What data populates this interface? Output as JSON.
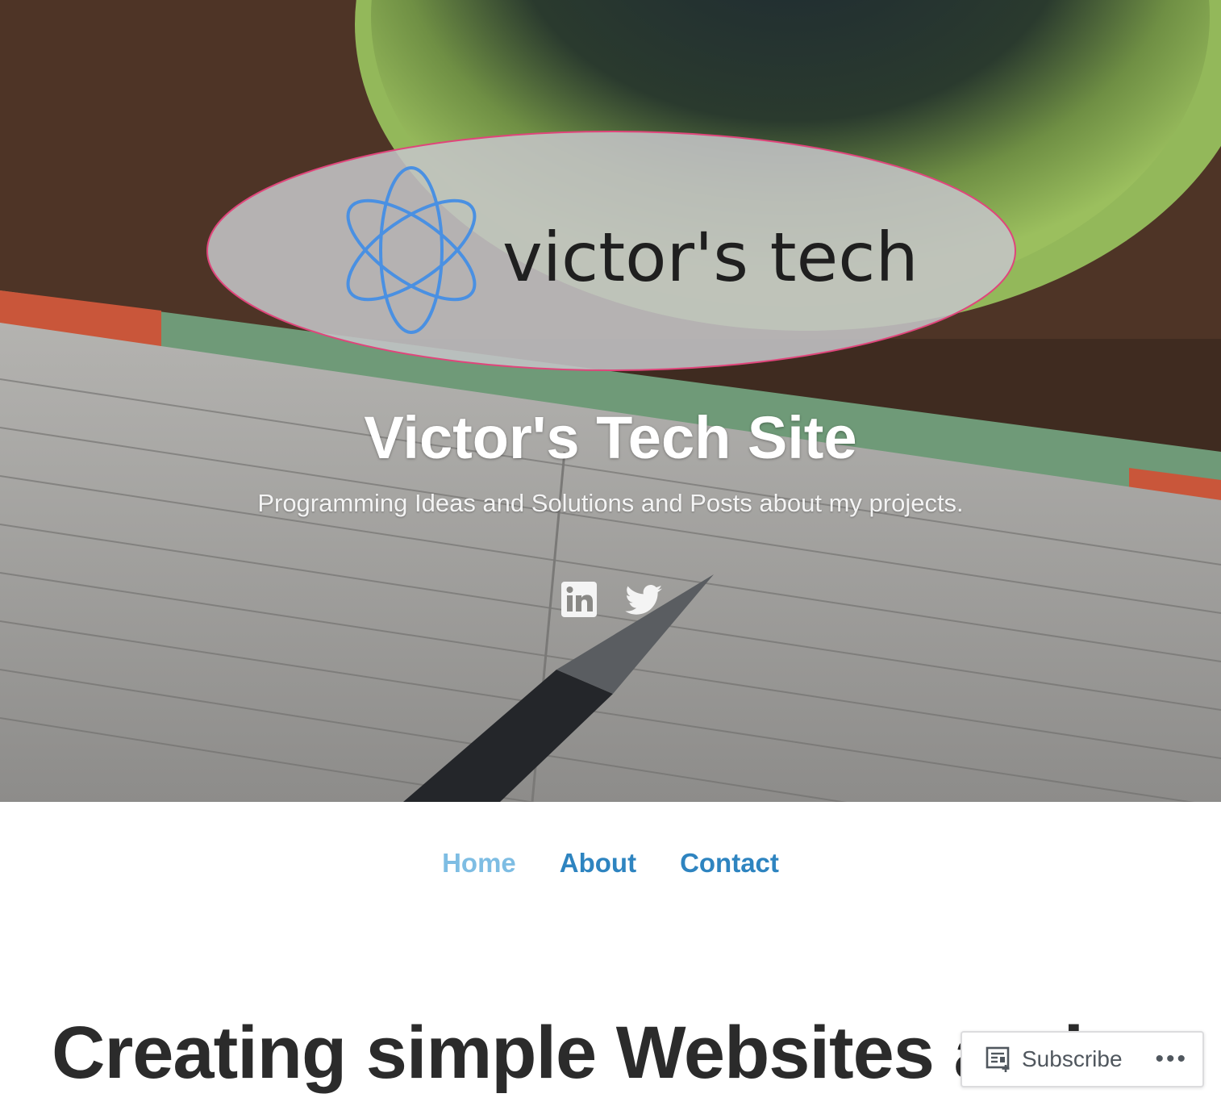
{
  "header": {
    "logo_text": "victor's tech",
    "site_title": "Victor's Tech Site",
    "tagline": "Programming Ideas and Solutions and Posts about my projects."
  },
  "social": {
    "items": [
      {
        "label": "LinkedIn",
        "icon": "linkedin-icon"
      },
      {
        "label": "Twitter",
        "icon": "twitter-icon"
      }
    ]
  },
  "nav": {
    "items": [
      {
        "label": "Home",
        "current": true
      },
      {
        "label": "About",
        "current": false
      },
      {
        "label": "Contact",
        "current": false
      }
    ]
  },
  "post": {
    "title": "Creating simple Websites and"
  },
  "subscribe_bar": {
    "label": "Subscribe",
    "more": "•••",
    "icon": "reader-subscribe-icon"
  },
  "colors": {
    "nav_link": "#2e84c0",
    "nav_current": "#7ebde3",
    "logo_atom": "#4a90e2",
    "logo_border": "#e0457b"
  }
}
